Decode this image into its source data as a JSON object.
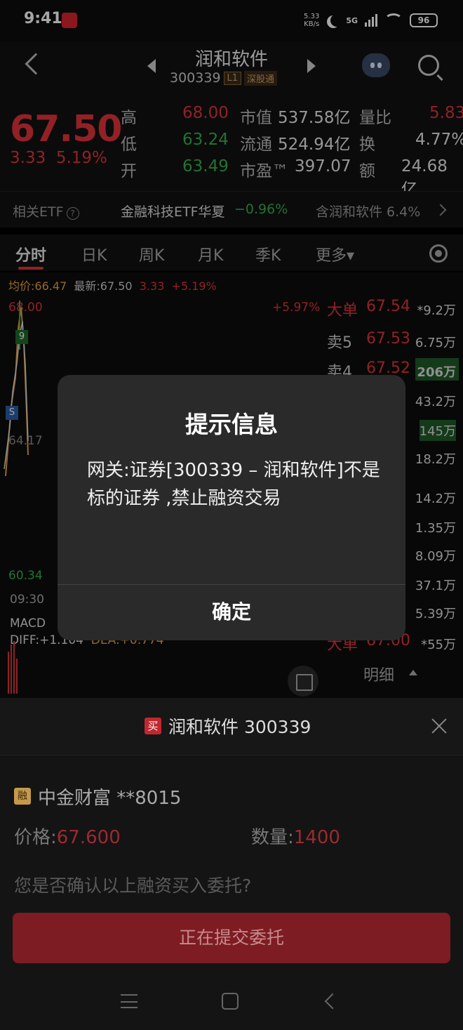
{
  "status_bar": {
    "time": "9:41",
    "net_speed_value": "5.33",
    "net_speed_unit": "KB/s",
    "signal": "5G",
    "battery": "96"
  },
  "header": {
    "stock_name": "润和软件",
    "stock_code": "300339",
    "tag_level": "L1",
    "tag_market": "深股通"
  },
  "quote": {
    "price": "67.50",
    "change": "3.33",
    "change_pct": "5.19%",
    "high_label": "高",
    "high": "68.00",
    "low_label": "低",
    "low": "63.24",
    "open_label": "开",
    "open": "63.49",
    "mktcap_label": "市值",
    "mktcap": "537.58亿",
    "float_label": "流通",
    "float": "524.94亿",
    "pe_label": "市盈™",
    "pe": "397.07",
    "volratio_label": "量比",
    "volratio": "5.83",
    "turnover_label": "换",
    "turnover": "4.77%",
    "amount_label": "额",
    "amount": "24.68亿"
  },
  "etf": {
    "label": "相关ETF",
    "name": "金融科技ETF华夏",
    "pct": "−0.96%",
    "contains": "含润和软件 6.4%"
  },
  "tabs": [
    "分时",
    "日K",
    "周K",
    "月K",
    "季K",
    "更多▾"
  ],
  "chart": {
    "avg_label": "均价:66.47",
    "latest_label": "最新:67.50",
    "chg": "3.33",
    "chg_pct": "+5.19%",
    "y_top": "68.00",
    "pct_top": "+5.97%",
    "y_mid": "64.17",
    "y_bot": "60.34",
    "time_start": "09:30",
    "badge_9": "9",
    "badge_s": "S",
    "macd_label": "MACD",
    "diff_label": "DIFF:+1.104",
    "dea_label": "DEA:+0.774"
  },
  "order_book": {
    "big_sell": {
      "name": "大单",
      "price": "67.54",
      "vol": "*9.2万"
    },
    "sell5": {
      "name": "卖5",
      "price": "67.53",
      "vol": "6.75万"
    },
    "sell4": {
      "name": "卖4",
      "price": "67.52",
      "vol": "206万"
    },
    "vols_partial": [
      "43.2万",
      "145万",
      "18.2万",
      "14.2万",
      "1.35万",
      "8.09万",
      "37.1万",
      "5.39万"
    ],
    "big_buy": {
      "name": "大单",
      "price": "67.00",
      "vol": "*55万"
    },
    "detail": "明细"
  },
  "dialog": {
    "title": "提示信息",
    "message": "网关:证券[300339 – 润和软件]不是标的证券 ,禁止融资交易",
    "ok": "确定"
  },
  "sheet": {
    "buy_tag": "买",
    "title": "润和软件 300339",
    "rong_tag": "融",
    "account": "中金财富 **8015",
    "price_label": "价格:",
    "price_value": "67.600",
    "qty_label": "数量:",
    "qty_value": "1400",
    "confirm_question": "您是否确认以上融资买入委托?",
    "submit": "正在提交委托"
  },
  "colors": {
    "up": "#e0343b",
    "down": "#34b04f",
    "submit_bg": "#7d1c22"
  }
}
